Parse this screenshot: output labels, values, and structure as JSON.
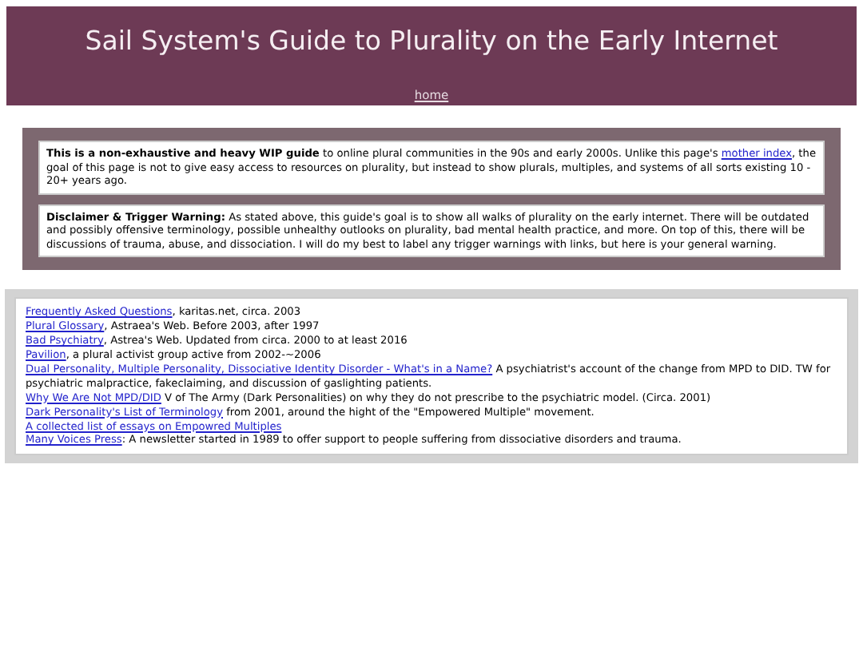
{
  "header": {
    "title": "Sail System's Guide to Plurality on the Early Internet",
    "nav_link": "home"
  },
  "intro": [
    {
      "before": "**This is a non-exhaustive and heavy WIP guide** to online plural communities in the 90s and early 2000s. Unlike this page's ",
      "link": "mother index",
      "after": ", the goal of this page is not to give easy access to resources on plurality, but instead to show plurals, multiples, and systems of all sorts existing 10 - 20+ years ago."
    },
    {
      "before": "**Disclaimer & Trigger Warning:** As stated above, this guide's goal is to show all walks of plurality on the early internet. There will be outdated and possibly offensive terminology, possible unhealthy outlooks on plurality, bad mental health practice, and more. On top of this, there will be discussions of trauma, abuse, and dissociation. I will do my best to label any trigger warnings with links, but here is your general warning."
    }
  ],
  "resources": [
    {
      "link": "Frequently Asked Questions",
      "text": ", karitas.net, circa. 2003"
    },
    {
      "link": "Plural Glossary",
      "text": ", Astraea's Web. Before 2003, after 1997"
    },
    {
      "link": "Bad Psychiatry",
      "text": ", Astrea's Web. Updated from circa. 2000 to at least 2016"
    },
    {
      "link": "Pavilion",
      "text": ", a plural activist group active from 2002-~2006"
    },
    {
      "link": "Dual Personality, Multiple Personality, Dissociative Identity Disorder - What's in a Name?",
      "text": " A psychiatrist's account of the change from MPD to DID. TW for psychiatric malpractice, fakeclaiming, and discussion of gaslighting patients."
    },
    {
      "link": "Why We Are Not MPD/DID",
      "text": " V of The Army (Dark Personalities) on why they do not prescribe to the psychiatric model. (Circa. 2001)"
    },
    {
      "link": "Dark Personality's List of Terminology",
      "text": " from 2001, around the hight of the \"Empowered Multiple\" movement."
    },
    {
      "link": "A collected list of essays on Empowred Multiples"
    },
    {
      "link": "Many Voices Press",
      "text": ": A newsletter started in 1989 to offer support to people suffering from dissociative disorders and trauma."
    }
  ]
}
